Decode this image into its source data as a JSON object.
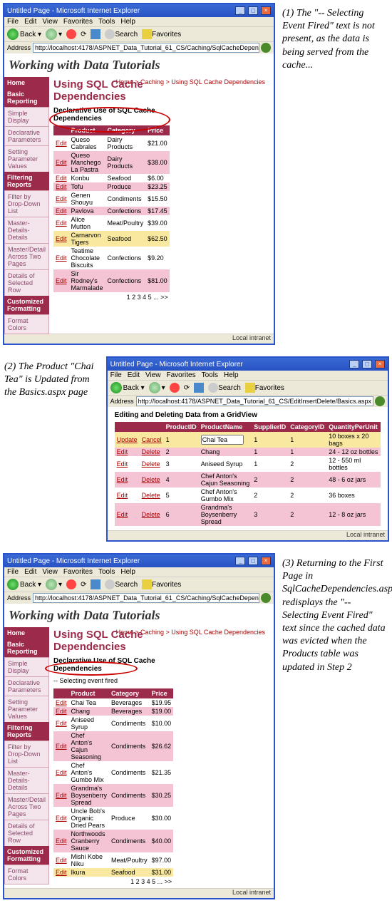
{
  "captions": {
    "c1": "(1) The \"-- Selecting Event Fired\" text is not present, as the data is being served from the cache...",
    "c2": "(2) The Product \"Chai Tea\" is Updated from the Basics.aspx page",
    "c3": "(3) Returning to the First Page in SqlCacheDependencies.aspx redisplays the \"-- Selecting Event Fired\" text since the cached data was evicted when the Products table was updated in Step 2"
  },
  "ie": {
    "title": "Untitled Page - Microsoft Internet Explorer",
    "menu": [
      "File",
      "Edit",
      "View",
      "Favorites",
      "Tools",
      "Help"
    ],
    "tb": {
      "back": "Back",
      "search": "Search",
      "fav": "Favorites"
    },
    "addressLbl": "Address",
    "url1": "http://localhost:4178/ASPNET_Data_Tutorial_61_CS/Caching/SqlCacheDependencies.aspx",
    "url2": "http://localhost:4178/ASPNET_Data_Tutorial_61_CS/EditInsertDelete/Basics.aspx",
    "status": "Local intranet"
  },
  "site": {
    "header": "Working with Data Tutorials",
    "crumb1": {
      "p": [
        "Home",
        "Caching",
        "Using SQL Cache Dependencies"
      ]
    },
    "nav": [
      {
        "h": 1,
        "t": "Home"
      },
      {
        "h": 1,
        "t": "Basic Reporting"
      },
      {
        "t": "Simple Display"
      },
      {
        "t": "Declarative Parameters"
      },
      {
        "t": "Setting Parameter Values"
      },
      {
        "h": 1,
        "t": "Filtering Reports"
      },
      {
        "t": "Filter by Drop-Down List"
      },
      {
        "t": "Master-Details-Details"
      },
      {
        "t": "Master/Detail Across Two Pages"
      },
      {
        "t": "Details of Selected Row"
      },
      {
        "h": 1,
        "t": "Customized Formatting"
      },
      {
        "t": "Format Colors"
      }
    ],
    "page1": {
      "h2": "Using SQL Cache Dependencies",
      "h3": "Declarative Use of SQL Cache Dependencies",
      "cols": [
        "Product",
        "Category",
        "Price"
      ],
      "rows": [
        {
          "a": 0,
          "c": [
            "Queso Cabrales",
            "Dairy Products",
            "$21.00"
          ]
        },
        {
          "a": 1,
          "c": [
            "Queso Manchego La Pastra",
            "Dairy Products",
            "$38.00"
          ]
        },
        {
          "a": 0,
          "c": [
            "Konbu",
            "Seafood",
            "$6.00"
          ]
        },
        {
          "a": 1,
          "c": [
            "Tofu",
            "Produce",
            "$23.25"
          ]
        },
        {
          "a": 0,
          "c": [
            "Genen Shouyu",
            "Condiments",
            "$15.50"
          ]
        },
        {
          "a": 1,
          "c": [
            "Pavlova",
            "Confections",
            "$17.45"
          ]
        },
        {
          "a": 0,
          "c": [
            "Alice Mutton",
            "Meat/Poultry",
            "$39.00"
          ]
        },
        {
          "a": 2,
          "c": [
            "Carnarvon Tigers",
            "Seafood",
            "$62.50"
          ]
        },
        {
          "a": 0,
          "c": [
            "Teatime Chocolate Biscuits",
            "Confections",
            "$9.20"
          ]
        },
        {
          "a": 1,
          "c": [
            "Sir Rodney's Marmalade",
            "Confections",
            "$81.00"
          ]
        }
      ],
      "pager": "1 2 3 4 5 ... >>"
    },
    "page2": {
      "h3": "Editing and Deleting Data from a GridView",
      "cols": [
        "",
        "",
        "ProductID",
        "ProductName",
        "SupplierID",
        "CategoryID",
        "QuantityPerUnit"
      ],
      "rows": [
        {
          "a": 2,
          "l": [
            "Update",
            "Cancel"
          ],
          "c": [
            "1",
            "Chai Tea|",
            "1",
            "1",
            "10 boxes x 20 bags"
          ]
        },
        {
          "a": 1,
          "l": [
            "Edit",
            "Delete"
          ],
          "c": [
            "2",
            "Chang",
            "1",
            "1",
            "24 - 12 oz bottles"
          ]
        },
        {
          "a": 0,
          "l": [
            "Edit",
            "Delete"
          ],
          "c": [
            "3",
            "Aniseed Syrup",
            "1",
            "2",
            "12 - 550 ml bottles"
          ]
        },
        {
          "a": 1,
          "l": [
            "Edit",
            "Delete"
          ],
          "c": [
            "4",
            "Chef Anton's Cajun Seasoning",
            "2",
            "2",
            "48 - 6 oz jars"
          ]
        },
        {
          "a": 0,
          "l": [
            "Edit",
            "Delete"
          ],
          "c": [
            "5",
            "Chef Anton's Gumbo Mix",
            "2",
            "2",
            "36 boxes"
          ]
        },
        {
          "a": 1,
          "l": [
            "Edit",
            "Delete"
          ],
          "c": [
            "6",
            "Grandma's Boysenberry Spread",
            "3",
            "2",
            "12 - 8 oz jars"
          ]
        }
      ]
    },
    "page3": {
      "h2": "Using SQL Cache Dependencies",
      "h3": "Declarative Use of SQL Cache Dependencies",
      "fired": "-- Selecting event fired",
      "cols": [
        "Product",
        "Category",
        "Price"
      ],
      "rows": [
        {
          "a": 0,
          "c": [
            "Chai Tea",
            "Beverages",
            "$19.95"
          ]
        },
        {
          "a": 1,
          "c": [
            "Chang",
            "Beverages",
            "$19.00"
          ]
        },
        {
          "a": 0,
          "c": [
            "Aniseed Syrup",
            "Condiments",
            "$10.00"
          ]
        },
        {
          "a": 1,
          "c": [
            "Chef Anton's Cajun Seasoning",
            "Condiments",
            "$26.62"
          ]
        },
        {
          "a": 0,
          "c": [
            "Chef Anton's Gumbo Mix",
            "Condiments",
            "$21.35"
          ]
        },
        {
          "a": 1,
          "c": [
            "Grandma's Boysenberry Spread",
            "Condiments",
            "$30.25"
          ]
        },
        {
          "a": 0,
          "c": [
            "Uncle Bob's Organic Dried Pears",
            "Produce",
            "$30.00"
          ]
        },
        {
          "a": 1,
          "c": [
            "Northwoods Cranberry Sauce",
            "Condiments",
            "$40.00"
          ]
        },
        {
          "a": 0,
          "c": [
            "Mishi Kobe Niku",
            "Meat/Poultry",
            "$97.00"
          ]
        },
        {
          "a": 2,
          "c": [
            "Ikura",
            "Seafood",
            "$31.00"
          ]
        }
      ],
      "pager": "1 2 3 4 5 ... >>"
    },
    "edit": "Edit"
  }
}
